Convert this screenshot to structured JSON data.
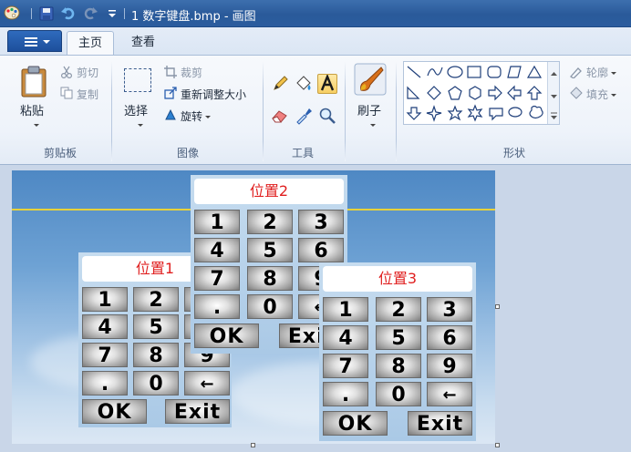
{
  "window": {
    "title": "1 数字键盘.bmp - 画图"
  },
  "tabs": [
    {
      "label": "主页",
      "active": true
    },
    {
      "label": "查看",
      "active": false
    }
  ],
  "ribbon": {
    "clipboard": {
      "paste": "粘贴",
      "cut": "剪切",
      "copy": "复制",
      "label": "剪贴板"
    },
    "image": {
      "select": "选择",
      "crop": "裁剪",
      "resize": "重新调整大小",
      "rotate": "旋转",
      "label": "图像"
    },
    "tools": {
      "label": "工具"
    },
    "brushes": {
      "label": "刷子"
    },
    "shapes": {
      "outline": "轮廓",
      "fill": "填充",
      "label": "形状"
    }
  },
  "canvas": {
    "keypads": [
      {
        "title": "位置1"
      },
      {
        "title": "位置2"
      },
      {
        "title": "位置3"
      }
    ],
    "keys": {
      "row1": [
        "1",
        "2",
        "3"
      ],
      "row2": [
        "4",
        "5",
        "6"
      ],
      "row3": [
        "7",
        "8",
        "9"
      ],
      "row4": [
        ".",
        "0",
        "←"
      ],
      "ok": "OK",
      "exit": "Exit"
    }
  },
  "colors": {
    "title_text": "#e02020",
    "selected_tool": "#f7cf63",
    "sky_top": "#4e88c4",
    "horizon_line": "#e8d23a"
  }
}
